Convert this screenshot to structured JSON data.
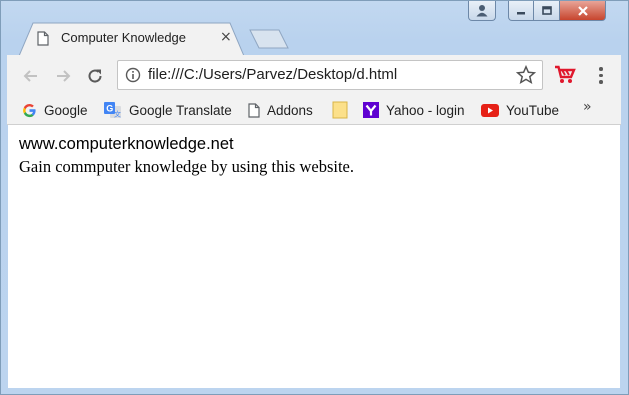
{
  "window": {
    "tab_title": "Computer Knowledge",
    "tab_close": "×",
    "controls": {
      "minimize": "–",
      "maximize": "▫",
      "close": "✕"
    }
  },
  "toolbar": {
    "url": "file:///C:/Users/Parvez/Desktop/d.html"
  },
  "bookmarks": {
    "items": [
      {
        "label": "Google",
        "icon": "google-g-icon"
      },
      {
        "label": "Google Translate",
        "icon": "google-translate-icon"
      },
      {
        "label": "Addons",
        "icon": "page-icon"
      },
      {
        "label": "",
        "icon": "folder-icon"
      },
      {
        "label": "Yahoo - login",
        "icon": "yahoo-icon"
      },
      {
        "label": "YouTube",
        "icon": "youtube-icon"
      }
    ],
    "overflow": "»"
  },
  "page": {
    "heading": "www.computerknowledge.net",
    "text": "Gain commputer knowledge by using this website."
  },
  "colors": {
    "frame": "#bcd4ef",
    "toolbar": "#f2f2f2",
    "close_button": "#c7452e",
    "extension": "#e0182d"
  }
}
